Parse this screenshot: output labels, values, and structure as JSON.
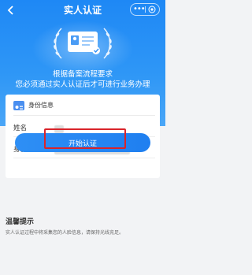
{
  "header": {
    "title": "实人认证",
    "back_icon": "chevron-left-icon",
    "more_icon": "dots-icon",
    "target_icon": "target-icon"
  },
  "hero": {
    "line1": "根据备案流程要求",
    "line2": "您必须通过实人认证后才可进行业务办理",
    "illustration": "id-card-laurel-icon"
  },
  "card": {
    "title": "身份信息",
    "name_label": "姓名",
    "id_label": "身份证号"
  },
  "action": {
    "start_label": "开始认证"
  },
  "tips": {
    "title": "温馨提示",
    "text": "实人认证过程中将采集您的人脸信息，请保持光线充足。"
  },
  "colors": {
    "primary": "#1f86f2",
    "highlight": "#d9242b"
  }
}
